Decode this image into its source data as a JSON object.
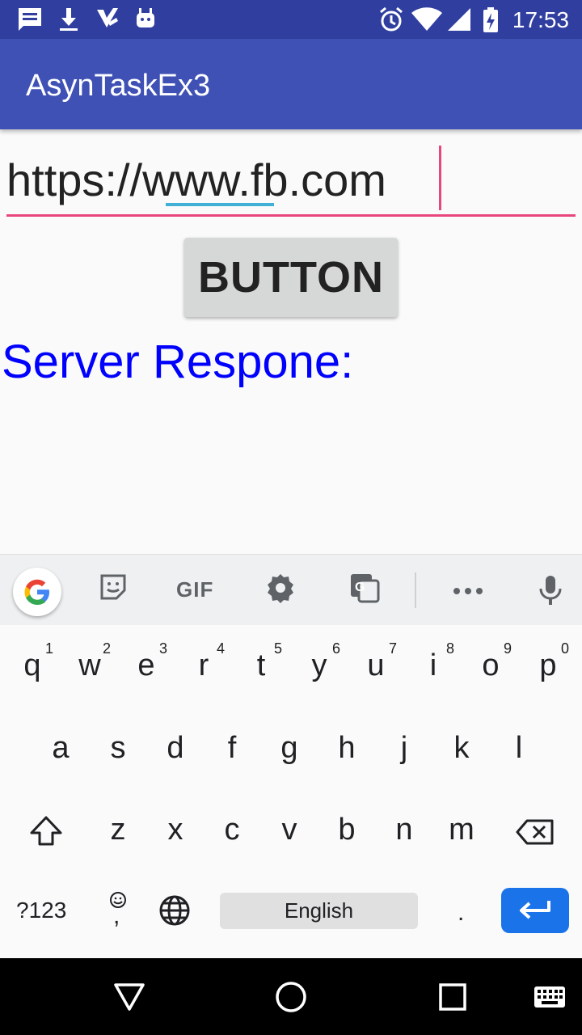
{
  "status_bar": {
    "time": "17:53",
    "icons": [
      "message-icon",
      "download-icon",
      "checkmark-icon",
      "android-icon",
      "alarm-icon",
      "wifi-icon",
      "signal-icon",
      "battery-charging-icon"
    ]
  },
  "app_bar": {
    "title": "AsynTaskEx3"
  },
  "url_field": {
    "value": "https://www.fb.com"
  },
  "button": {
    "label": "BUTTON"
  },
  "response": {
    "label": "Server Respone:"
  },
  "keyboard": {
    "toolbar": {
      "gif": "GIF"
    },
    "row1": [
      "q",
      "w",
      "e",
      "r",
      "t",
      "y",
      "u",
      "i",
      "o",
      "p"
    ],
    "row1_hints": [
      "1",
      "2",
      "3",
      "4",
      "5",
      "6",
      "7",
      "8",
      "9",
      "0"
    ],
    "row2": [
      "a",
      "s",
      "d",
      "f",
      "g",
      "h",
      "j",
      "k",
      "l"
    ],
    "row3": [
      "z",
      "x",
      "c",
      "v",
      "b",
      "n",
      "m"
    ],
    "symbols": "?123",
    "comma": ",",
    "space": "English",
    "period": ".",
    "colors": {
      "enter": "#1a73e8",
      "accent": "#e8467c"
    }
  }
}
